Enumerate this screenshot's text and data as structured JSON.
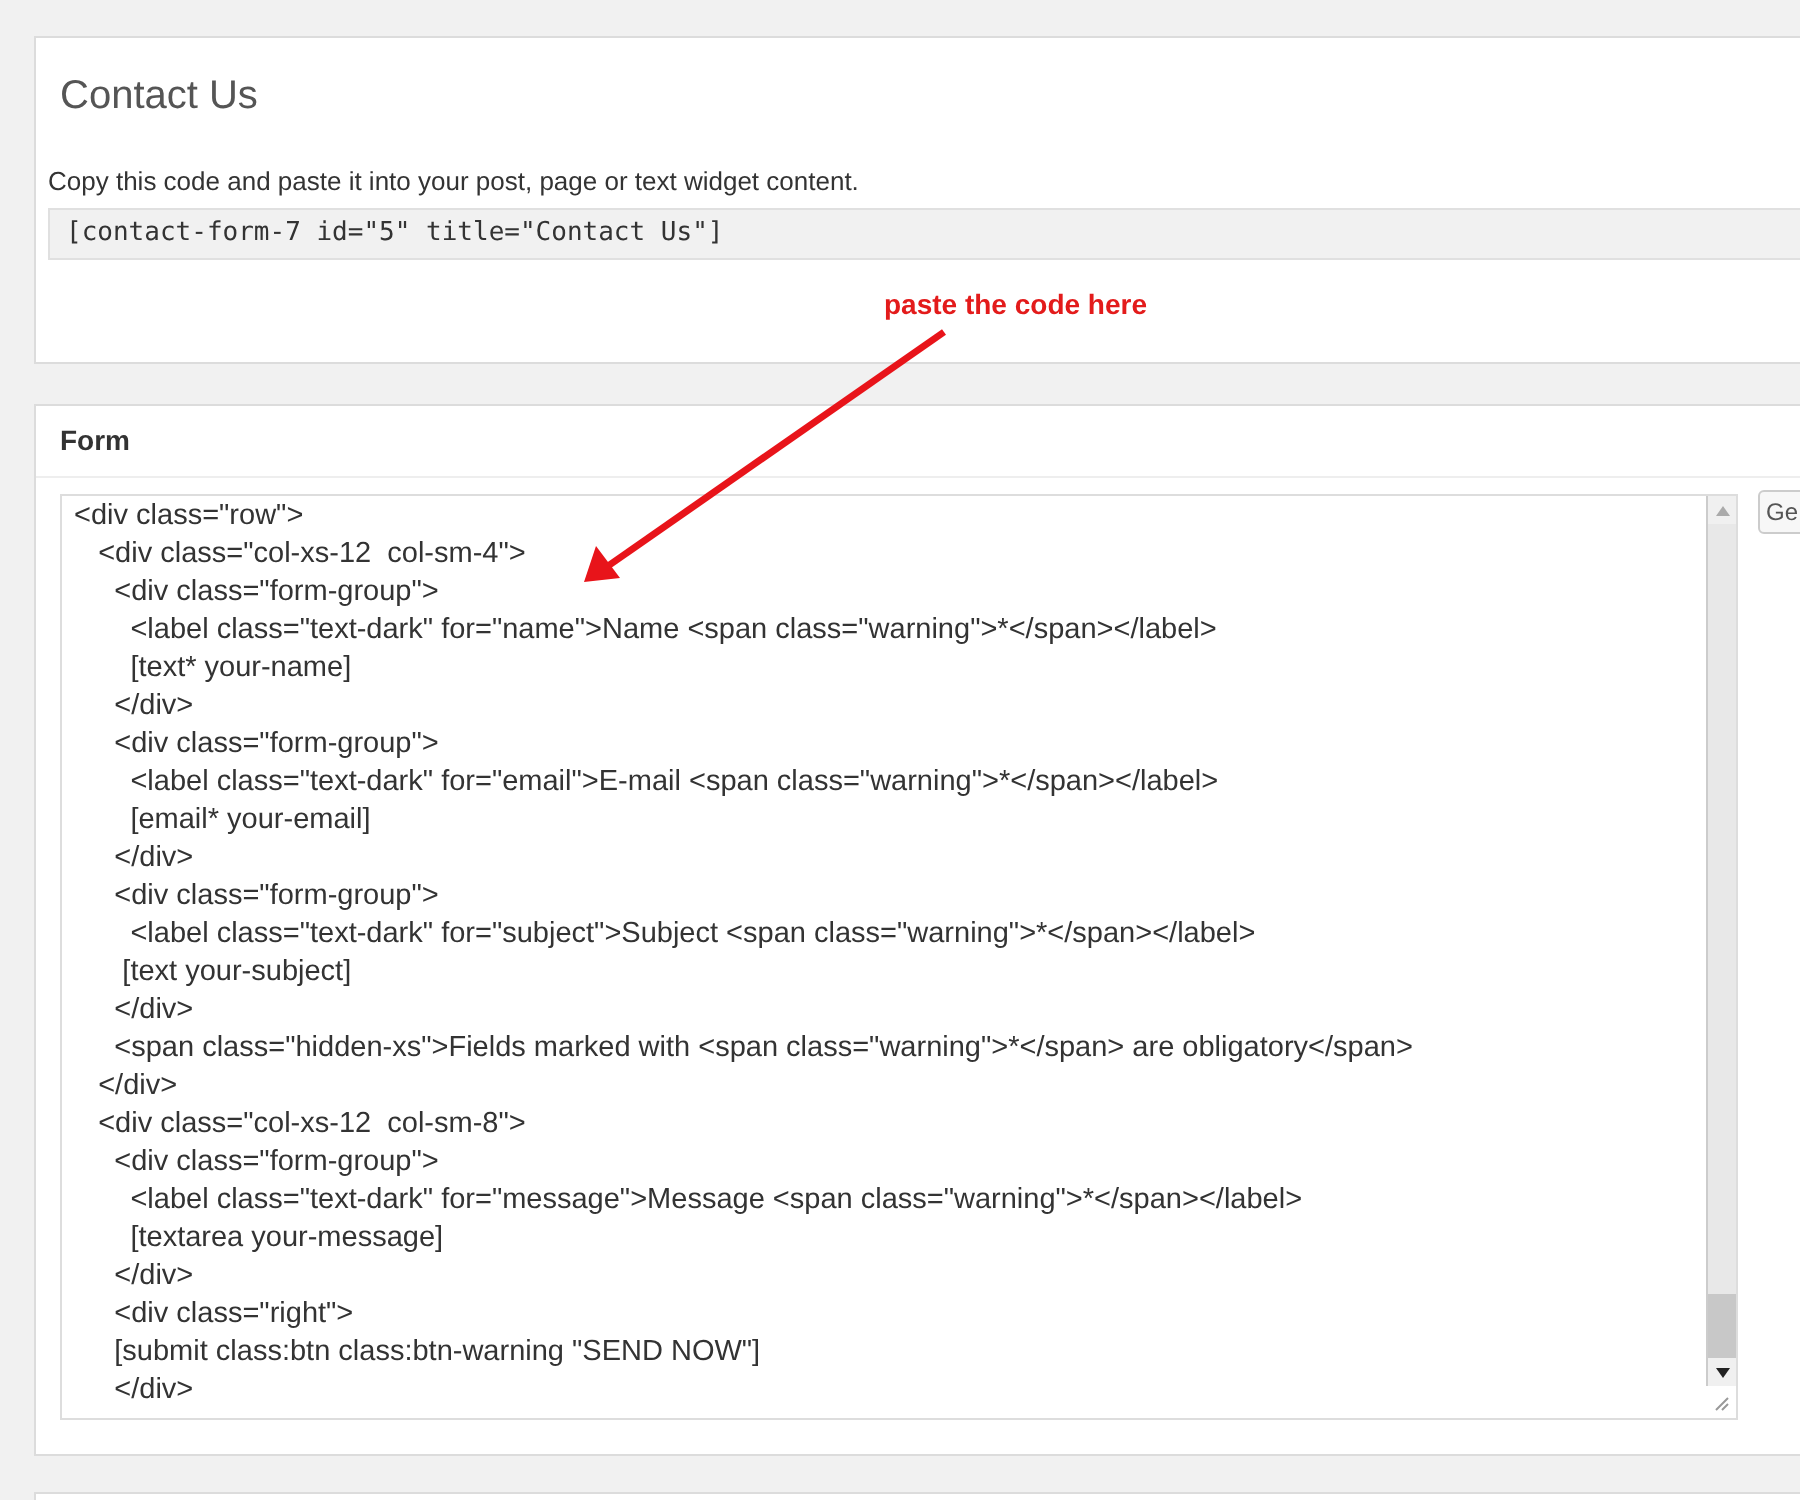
{
  "shortcode_panel": {
    "title": "Contact Us",
    "description": "Copy this code and paste it into your post, page or text widget content.",
    "shortcode": "[contact-form-7 id=\"5\" title=\"Contact Us\"]"
  },
  "annotation": {
    "text": "paste the code here"
  },
  "form_panel": {
    "title": "Form",
    "code_lines": [
      "<div class=\"row\">",
      "   <div class=\"col-xs-12  col-sm-4\">",
      "     <div class=\"form-group\">",
      "       <label class=\"text-dark\" for=\"name\">Name <span class=\"warning\">*</span></label>",
      "       [text* your-name]",
      "     </div>",
      "     <div class=\"form-group\">",
      "       <label class=\"text-dark\" for=\"email\">E-mail <span class=\"warning\">*</span></label>",
      "       [email* your-email]",
      "     </div>",
      "     <div class=\"form-group\">",
      "       <label class=\"text-dark\" for=\"subject\">Subject <span class=\"warning\">*</span></label>",
      "      [text your-subject]",
      "     </div>",
      "     <span class=\"hidden-xs\">Fields marked with <span class=\"warning\">*</span> are obligatory</span>",
      "   </div>",
      "   <div class=\"col-xs-12  col-sm-8\">",
      "     <div class=\"form-group\">",
      "       <label class=\"text-dark\" for=\"message\">Message <span class=\"warning\">*</span></label>",
      "       [textarea your-message]",
      "     </div>",
      "     <div class=\"right\">",
      "     [submit class:btn class:btn-warning \"SEND NOW\"]",
      "     </div>"
    ],
    "side_button": "Ge"
  }
}
